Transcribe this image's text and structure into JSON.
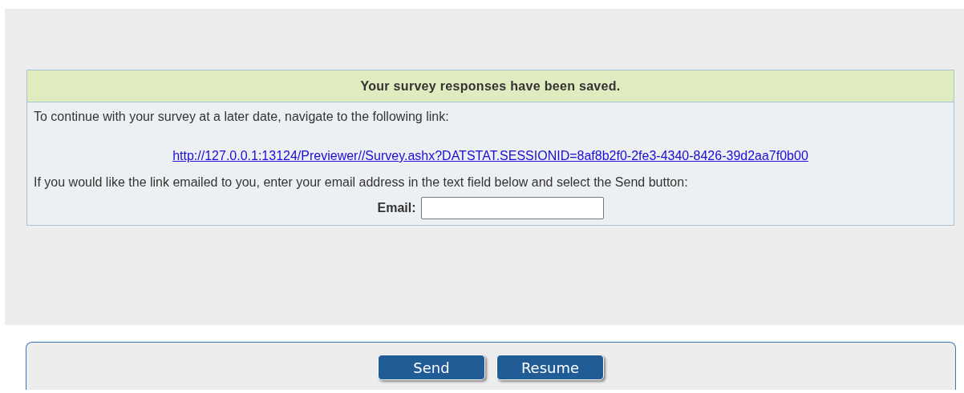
{
  "message": {
    "heading": "Your survey responses have been saved.",
    "intro": "To continue with your survey at a later date, navigate to the following link:",
    "link": "http://127.0.0.1:13124/Previewer//Survey.ashx?DATSTAT.SESSIONID=8af8b2f0-2fe3-4340-8426-39d2aa7f0b00",
    "email_prompt": "If you would like the link emailed to you, enter your email address in the text field below and select the Send button:",
    "email_label": "Email:"
  },
  "buttons": [
    "Send",
    "Resume"
  ]
}
